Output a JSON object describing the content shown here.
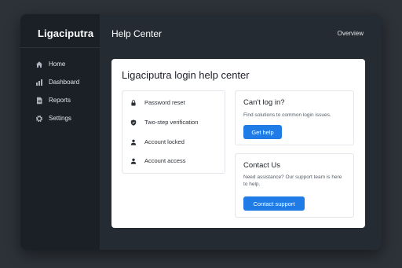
{
  "app": {
    "brand": "Ligaciputra"
  },
  "sidebar": {
    "items": [
      {
        "label": "Home",
        "icon": "home-icon"
      },
      {
        "label": "Dashboard",
        "icon": "bar-chart-icon"
      },
      {
        "label": "Reports",
        "icon": "document-icon"
      },
      {
        "label": "Settings",
        "icon": "gear-icon"
      }
    ]
  },
  "header": {
    "title": "Help Center",
    "overview_link": "Overview"
  },
  "main": {
    "title": "Ligaciputra login help center",
    "topics": [
      {
        "label": "Password reset",
        "icon": "lock-icon"
      },
      {
        "label": "Two-step verification",
        "icon": "shield-icon"
      },
      {
        "label": "Account locked",
        "icon": "user-icon"
      },
      {
        "label": "Account access",
        "icon": "user-icon"
      }
    ],
    "cant_login": {
      "title": "Can't log in?",
      "text": "Find solutions to common login issues.",
      "button": "Get help"
    },
    "contact": {
      "title": "Contact Us",
      "text": "Need assistance? Our support team is here to help.",
      "button": "Contact support"
    }
  },
  "colors": {
    "accent": "#1f7be6",
    "sidebar": "#1b2027",
    "background": "#2d3238"
  }
}
